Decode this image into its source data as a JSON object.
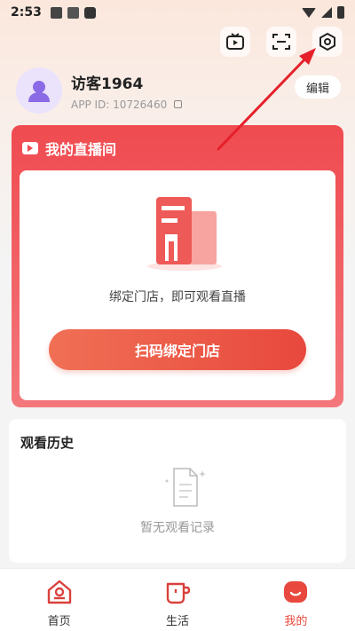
{
  "status_bar": {
    "time": "2:53"
  },
  "profile": {
    "username": "访客1964",
    "app_id": "APP ID: 10726460",
    "edit_label": "编辑"
  },
  "live_room": {
    "title": "我的直播间",
    "bind_tip": "绑定门店，即可观看直播",
    "scan_button": "扫码绑定门店"
  },
  "history": {
    "title": "观看历史",
    "empty_text": "暂无观看记录"
  },
  "bottom_nav": {
    "items": [
      {
        "label": "首页",
        "icon": "home-icon"
      },
      {
        "label": "生活",
        "icon": "cup-icon"
      },
      {
        "label": "我的",
        "icon": "profile-icon",
        "active": true
      }
    ]
  },
  "colors": {
    "accent": "#e8483d",
    "card_red": "#ef4b50",
    "annotation_arrow": "#e5202a"
  }
}
